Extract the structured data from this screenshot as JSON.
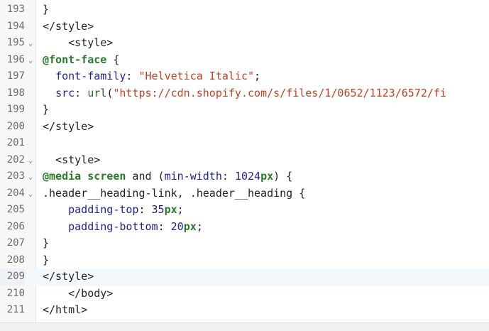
{
  "editor": {
    "active_line": "209",
    "lines": [
      {
        "number": "193",
        "foldable": false,
        "tokens": [
          {
            "text": "}",
            "kind": "plain"
          }
        ]
      },
      {
        "number": "194",
        "foldable": false,
        "tokens": [
          {
            "text": "</style>",
            "kind": "plain"
          }
        ]
      },
      {
        "number": "195",
        "foldable": true,
        "tokens": [
          {
            "text": "    <style>",
            "kind": "plain"
          }
        ]
      },
      {
        "number": "196",
        "foldable": true,
        "tokens": [
          {
            "text": "@font-face",
            "kind": "at"
          },
          {
            "text": " {",
            "kind": "plain"
          }
        ]
      },
      {
        "number": "197",
        "foldable": false,
        "tokens": [
          {
            "text": "  ",
            "kind": "plain"
          },
          {
            "text": "font-family",
            "kind": "prop"
          },
          {
            "text": ": ",
            "kind": "plain"
          },
          {
            "text": "\"Helvetica Italic\"",
            "kind": "str"
          },
          {
            "text": ";",
            "kind": "plain"
          }
        ]
      },
      {
        "number": "198",
        "foldable": false,
        "tokens": [
          {
            "text": "  ",
            "kind": "plain"
          },
          {
            "text": "src",
            "kind": "prop"
          },
          {
            "text": ": ",
            "kind": "plain"
          },
          {
            "text": "url",
            "kind": "fn"
          },
          {
            "text": "(",
            "kind": "plain"
          },
          {
            "text": "\"https://cdn.shopify.com/s/files/1/0652/1123/6572/fi",
            "kind": "str"
          }
        ]
      },
      {
        "number": "199",
        "foldable": false,
        "tokens": [
          {
            "text": "}",
            "kind": "plain"
          }
        ]
      },
      {
        "number": "200",
        "foldable": false,
        "tokens": [
          {
            "text": "</style>",
            "kind": "plain"
          }
        ]
      },
      {
        "number": "201",
        "foldable": false,
        "tokens": []
      },
      {
        "number": "202",
        "foldable": true,
        "tokens": [
          {
            "text": "  <style>",
            "kind": "plain"
          }
        ]
      },
      {
        "number": "203",
        "foldable": true,
        "tokens": [
          {
            "text": "@media",
            "kind": "at"
          },
          {
            "text": " ",
            "kind": "plain"
          },
          {
            "text": "screen",
            "kind": "at"
          },
          {
            "text": " and (",
            "kind": "plain"
          },
          {
            "text": "min-width",
            "kind": "prop"
          },
          {
            "text": ": ",
            "kind": "plain"
          },
          {
            "text": "1024",
            "kind": "num"
          },
          {
            "text": "px",
            "kind": "unit"
          },
          {
            "text": ") {",
            "kind": "plain"
          }
        ]
      },
      {
        "number": "204",
        "foldable": true,
        "tokens": [
          {
            "text": ".header__heading-link, .header__heading {",
            "kind": "plain"
          }
        ]
      },
      {
        "number": "205",
        "foldable": false,
        "tokens": [
          {
            "text": "    ",
            "kind": "plain"
          },
          {
            "text": "padding-top",
            "kind": "prop"
          },
          {
            "text": ": ",
            "kind": "plain"
          },
          {
            "text": "35",
            "kind": "num"
          },
          {
            "text": "px",
            "kind": "unit"
          },
          {
            "text": ";",
            "kind": "plain"
          }
        ]
      },
      {
        "number": "206",
        "foldable": false,
        "tokens": [
          {
            "text": "    ",
            "kind": "plain"
          },
          {
            "text": "padding-bottom",
            "kind": "prop"
          },
          {
            "text": ": ",
            "kind": "plain"
          },
          {
            "text": "20",
            "kind": "num"
          },
          {
            "text": "px",
            "kind": "unit"
          },
          {
            "text": ";",
            "kind": "plain"
          }
        ]
      },
      {
        "number": "207",
        "foldable": false,
        "tokens": [
          {
            "text": "}",
            "kind": "plain"
          }
        ]
      },
      {
        "number": "208",
        "foldable": false,
        "tokens": [
          {
            "text": "}",
            "kind": "plain"
          }
        ]
      },
      {
        "number": "209",
        "foldable": false,
        "tokens": [
          {
            "text": "</style>",
            "kind": "plain"
          }
        ]
      },
      {
        "number": "210",
        "foldable": false,
        "tokens": [
          {
            "text": "    </body>",
            "kind": "plain"
          }
        ]
      },
      {
        "number": "211",
        "foldable": false,
        "tokens": [
          {
            "text": "</html>",
            "kind": "plain"
          }
        ]
      }
    ]
  },
  "icons": {
    "fold": "chevron-down-icon"
  },
  "colors": {
    "at_rule": "#287a2a",
    "property": "#1e1e9a",
    "string": "#c23e1c",
    "function": "#1d6b1d",
    "number": "#1e1e9a",
    "line_number": "#6e6e6e",
    "gutter_bg": "#f7f7f7",
    "active_line_bg": "#f3f8fd"
  }
}
